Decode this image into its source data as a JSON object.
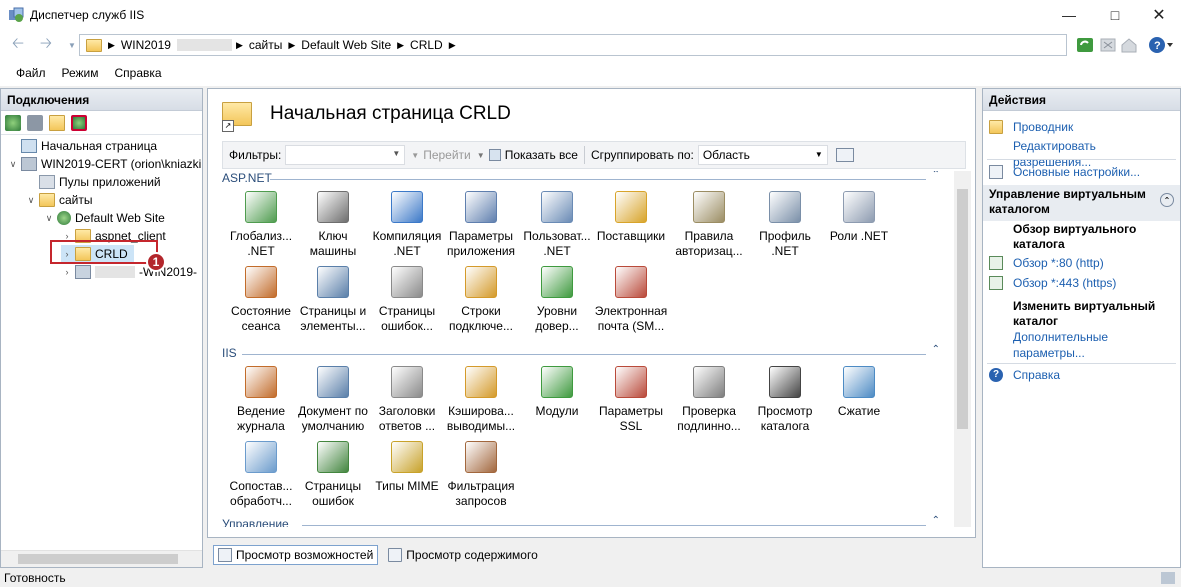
{
  "window": {
    "title": "Диспетчер служб IIS"
  },
  "address": {
    "segments": [
      "WIN2019",
      "сайты",
      "Default Web Site",
      "CRLD"
    ]
  },
  "menu": [
    "Файл",
    "Режим",
    "Справка"
  ],
  "connections": {
    "title": "Подключения",
    "tree": {
      "start": "Начальная страница",
      "server": "WIN2019-CERT (orion\\kniazki",
      "app_pools": "Пулы приложений",
      "sites": "сайты",
      "default_site": "Default Web Site",
      "aspnet_client": "aspnet_client",
      "crld": "CRLD",
      "other": "-WIN2019-"
    },
    "badge": "1"
  },
  "center": {
    "title": "Начальная страница CRLD",
    "filter_label": "Фильтры:",
    "go_label": "Перейти",
    "show_all_label": "Показать все",
    "group_label": "Сгруппировать по:",
    "group_value": "Область",
    "sections": {
      "aspnet": "ASP.NET",
      "iis": "IIS",
      "management": "Управление"
    },
    "aspnet_features": [
      [
        "Глобализ...",
        ".NET"
      ],
      [
        "Ключ",
        "машины"
      ],
      [
        "Компиляция",
        ".NET"
      ],
      [
        "Параметры",
        "приложения"
      ],
      [
        "Пользоват...",
        ".NET"
      ],
      [
        "Поставщики",
        ""
      ],
      [
        "Правила",
        "авторизац..."
      ],
      [
        "Профиль",
        ".NET"
      ],
      [
        "Роли .NET",
        ""
      ],
      [
        "Состояние",
        "сеанса"
      ],
      [
        "Страницы и",
        "элементы..."
      ],
      [
        "Страницы",
        "ошибок..."
      ],
      [
        "Строки",
        "подключе..."
      ],
      [
        "Уровни",
        "довер..."
      ],
      [
        "Электронная",
        "почта (SM..."
      ]
    ],
    "iis_features": [
      [
        "Ведение",
        "журнала"
      ],
      [
        "Документ по",
        "умолчанию"
      ],
      [
        "Заголовки",
        "ответов ..."
      ],
      [
        "Кэширова...",
        "выводимы..."
      ],
      [
        "Модули",
        ""
      ],
      [
        "Параметры",
        "SSL"
      ],
      [
        "Проверка",
        "подлинно..."
      ],
      [
        "Просмотр",
        "каталога"
      ],
      [
        "Сжатие",
        ""
      ],
      [
        "Сопостав...",
        "обработч..."
      ],
      [
        "Страницы",
        "ошибок"
      ],
      [
        "Типы MIME",
        ""
      ],
      [
        "Фильтрация",
        "запросов"
      ]
    ],
    "bottom_tabs": [
      "Просмотр возможностей",
      "Просмотр содержимого"
    ]
  },
  "actions": {
    "title": "Действия",
    "explore": "Проводник",
    "edit_permissions": "Редактировать разрешения...",
    "basic_settings": "Основные настройки...",
    "vdir_section": [
      "Управление виртуальным",
      "каталогом"
    ],
    "browse_title": [
      "Обзор виртуального",
      "каталога"
    ],
    "browse_80": "Обзор *:80 (http)",
    "browse_443": "Обзор *:443 (https)",
    "manage_title": [
      "Изменить виртуальный",
      "каталог"
    ],
    "advanced": [
      "Дополнительные",
      "параметры..."
    ],
    "help": "Справка"
  },
  "status": {
    "text": "Готовность"
  },
  "colors": {
    "link": "#1c5fb0",
    "badge": "#b3262c",
    "highlight": "#c5262d"
  }
}
